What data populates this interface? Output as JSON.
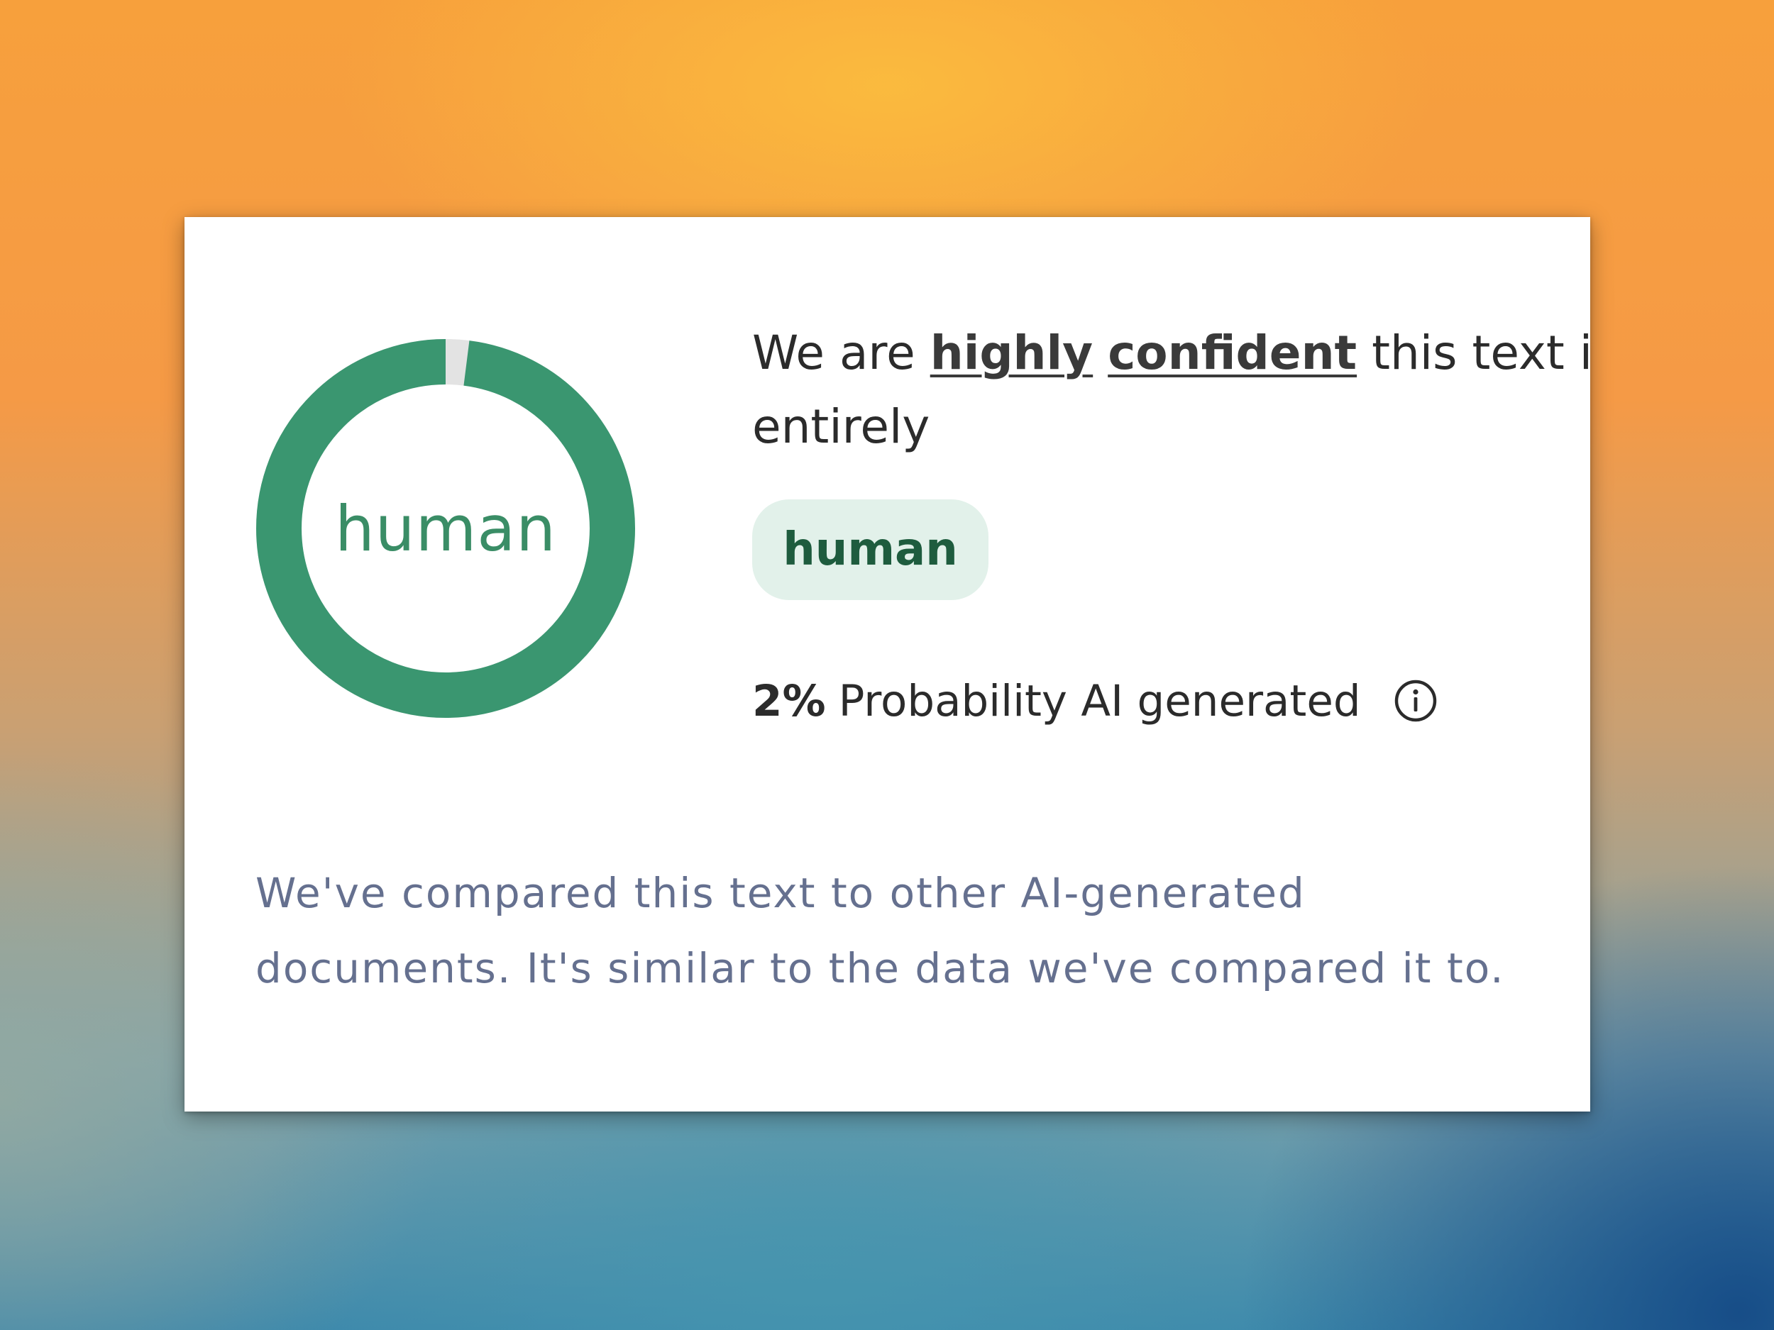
{
  "detector": {
    "gauge": {
      "label": "human",
      "ai_probability_percent": 2,
      "fill_color": "#3a9670",
      "track_color": "#e3e3e3"
    },
    "headline": {
      "part1": "We are ",
      "emphasis1": "highly",
      "emphasis2": "confident",
      "part2": " this text is",
      "part3": "entirely"
    },
    "classification_badge": {
      "label": "human",
      "background": "#e2f1ea",
      "text_color": "#1e5c3e"
    },
    "probability": {
      "percent_text": "2%",
      "label": "Probability AI generated",
      "info_icon": "info-circle-icon"
    },
    "description": {
      "line1": "We've compared this text to other AI-generated",
      "line2": "documents. It's similar to the data we've compared it to."
    }
  }
}
